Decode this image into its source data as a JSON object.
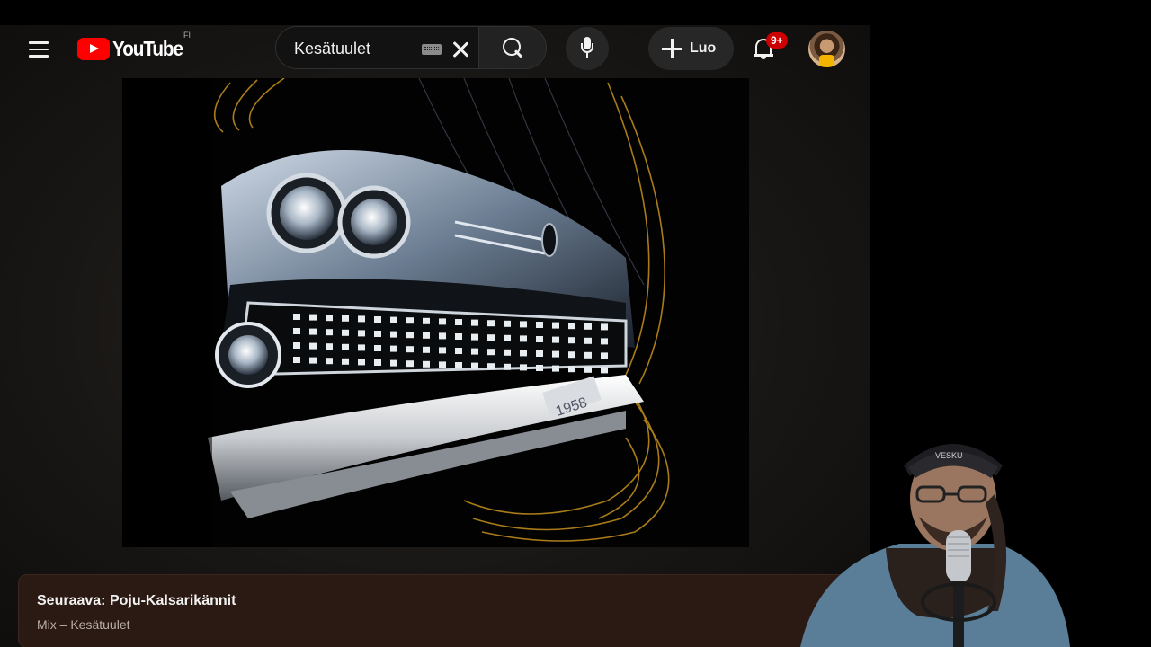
{
  "header": {
    "logo_text": "YouTube",
    "country_code": "FI",
    "search_value": "Kesätuulet",
    "create_label": "Luo",
    "notification_count": "9+"
  },
  "icons": {
    "menu": "hamburger-menu-icon",
    "logo": "youtube-logo-icon",
    "keyboard": "keyboard-icon",
    "clear": "close-icon",
    "search": "search-icon",
    "mic": "microphone-icon",
    "create": "plus-icon",
    "bell": "bell-icon"
  },
  "up_next": {
    "title": "Seuraava: Poju-Kalsarikännit",
    "subtitle": "Mix – Kesätuulet"
  },
  "webcam": {
    "cap_text": "VESKU"
  },
  "colors": {
    "brand_red": "#ff0000",
    "badge_red": "#cc0000",
    "background": "#0f0f0f",
    "banner_brown": "#2b1a13",
    "accent_gold": "#c8921e"
  }
}
